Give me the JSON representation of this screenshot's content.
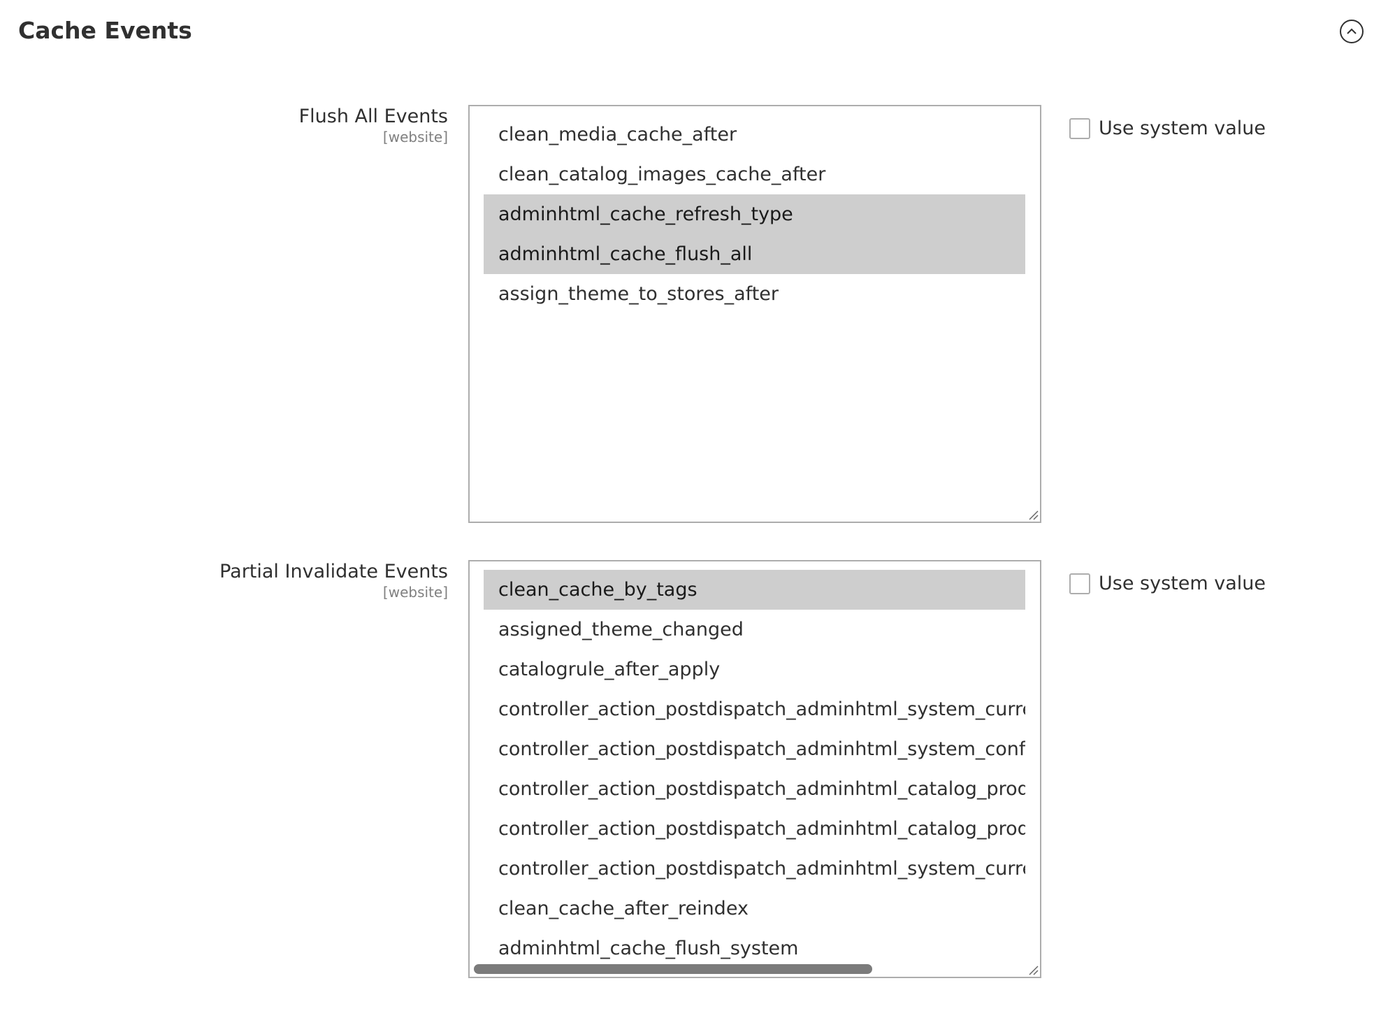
{
  "section": {
    "title": "Cache Events"
  },
  "icons": {
    "collapse": "chevron-up-circle-icon",
    "resize": "resize-grip-icon"
  },
  "colors": {
    "selected_option_bg": "#cecece",
    "text": "#303030",
    "scope_text": "#808080",
    "border": "#adadad"
  },
  "fields": [
    {
      "label": "Flush All Events",
      "scope": "[website]",
      "use_system_value_label": "Use system value",
      "use_system_value_checked": false,
      "options": [
        {
          "text": "clean_media_cache_after",
          "selected": false
        },
        {
          "text": "clean_catalog_images_cache_after",
          "selected": false
        },
        {
          "text": "adminhtml_cache_refresh_type",
          "selected": true
        },
        {
          "text": "adminhtml_cache_flush_all",
          "selected": true
        },
        {
          "text": "assign_theme_to_stores_after",
          "selected": false
        }
      ]
    },
    {
      "label": "Partial Invalidate Events",
      "scope": "[website]",
      "use_system_value_label": "Use system value",
      "use_system_value_checked": false,
      "options": [
        {
          "text": "clean_cache_by_tags",
          "selected": true
        },
        {
          "text": "assigned_theme_changed",
          "selected": false
        },
        {
          "text": "catalogrule_after_apply",
          "selected": false
        },
        {
          "text": "controller_action_postdispatch_adminhtml_system_currency",
          "selected": false
        },
        {
          "text": "controller_action_postdispatch_adminhtml_system_config_s",
          "selected": false
        },
        {
          "text": "controller_action_postdispatch_adminhtml_catalog_product",
          "selected": false
        },
        {
          "text": "controller_action_postdispatch_adminhtml_catalog_product",
          "selected": false
        },
        {
          "text": "controller_action_postdispatch_adminhtml_system_currency",
          "selected": false
        },
        {
          "text": "clean_cache_after_reindex",
          "selected": false
        },
        {
          "text": "adminhtml_cache_flush_system",
          "selected": false
        }
      ]
    }
  ]
}
